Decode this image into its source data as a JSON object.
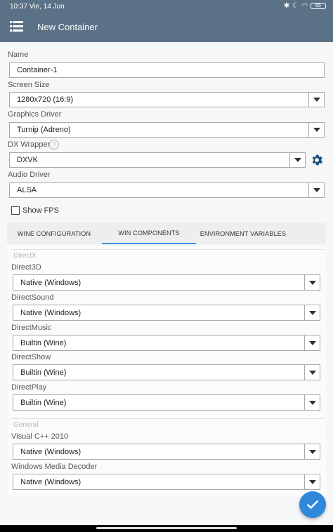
{
  "status_bar": {
    "time": "10:37 Vie, 14 Jun",
    "battery": "65"
  },
  "app_bar": {
    "title": "New Container"
  },
  "form": {
    "name_label": "Name",
    "name_value": "Container-1",
    "screen_size_label": "Screen Size",
    "screen_size_value": "1280x720 (16:9)",
    "graphics_driver_label": "Graphics Driver",
    "graphics_driver_value": "Turnip (Adreno)",
    "dx_wrapper_label": "DX Wrapper",
    "dx_wrapper_value": "DXVK",
    "audio_driver_label": "Audio Driver",
    "audio_driver_value": "ALSA",
    "show_fps_label": "Show FPS",
    "show_fps_checked": false
  },
  "tabs": [
    {
      "label": "WINE CONFIGURATION",
      "active": false
    },
    {
      "label": "WIN COMPONENTS",
      "active": true
    },
    {
      "label": "ENVIRONMENT VARIABLES",
      "active": false
    }
  ],
  "win_components": {
    "directx_title": "DirectX",
    "direct3d_label": "Direct3D",
    "direct3d_value": "Native (Windows)",
    "directsound_label": "DirectSound",
    "directsound_value": "Native (Windows)",
    "directmusic_label": "DirectMusic",
    "directmusic_value": "Builtin (Wine)",
    "directshow_label": "DirectShow",
    "directshow_value": "Builtin (Wine)",
    "directplay_label": "DirectPlay",
    "directplay_value": "Builtin (Wine)",
    "general_title": "General",
    "vcpp_label": "Visual C++ 2010",
    "vcpp_value": "Native (Windows)",
    "wmd_label": "Windows Media Decoder",
    "wmd_value": "Native (Windows)"
  },
  "colors": {
    "app_bar": "#5b7286",
    "accent": "#2f88db",
    "tab_indicator": "#3c8fd8"
  },
  "icons": {
    "menu": "list-menu-icon",
    "settings": "gear-icon",
    "help": "help-circle-icon",
    "confirm": "check-icon"
  }
}
